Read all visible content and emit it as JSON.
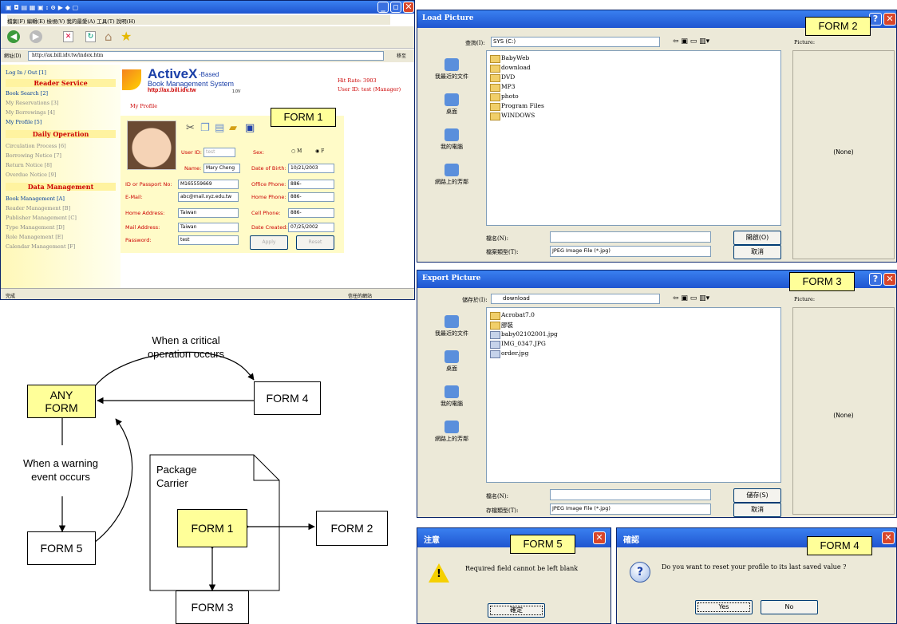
{
  "form1_browser": {
    "menu": "檔案(F)  編輯(E)  檢視(V)  我的最愛(A)  工具(T)  說明(H)",
    "address_label": "網址(D)",
    "url": "http://ax.bill.idv.tw/index.htm",
    "go": "移至",
    "logo_main": "ActiveX",
    "logo_based": "-Based",
    "logo_sub": "Book Management System",
    "logo_url": "http://ax.bill.idv.tw",
    "logo_ver": "1.0V",
    "hit_rate": "Hit Rate: 3903",
    "user_id": "User ID: test (Manager)",
    "sidebar": {
      "login": "Log In / Out [1]",
      "reader_head": "Reader Service",
      "reader_items": [
        "Book Search [2]",
        "My Reservations [3]",
        "My Borrowings [4]",
        "My Profile [5]"
      ],
      "daily_head": "Daily Operation",
      "daily_items": [
        "Circulation Process [6]",
        "Borrowing Notice [7]",
        "Return Notice [8]",
        "Overdue Notice [9]"
      ],
      "data_head": "Data Management",
      "data_items": [
        "Book Management [A]",
        "Reader Management [B]",
        "Publisher Management [C]",
        "Type Management [D]",
        "Role Management [E]",
        "Calendar Management [F]"
      ]
    },
    "profile_title": "My Profile",
    "fields": {
      "user_id_label": "User ID:",
      "user_id": "test",
      "name_label": "Name:",
      "name": "Mary Cheng",
      "sex_label": "Sex:",
      "sex_m": "M",
      "sex_f": "F",
      "dob_label": "Date of Birth:",
      "dob": "10/21/2003",
      "id_label": "ID or Passport No:",
      "id": "M165559669",
      "office_label": "Office Phone:",
      "office": "886-",
      "email_label": "E-Mail:",
      "email": "abc@mail.xyz.edu.tw",
      "home_phone_label": "Home Phone:",
      "home_phone": "886-",
      "home_addr_label": "Home Address:",
      "home_addr": "Taiwan",
      "cell_label": "Cell Phone:",
      "cell": "886-",
      "mail_addr_label": "Mail Address:",
      "mail_addr": "Taiwan",
      "created_label": "Date Created:",
      "created": "07/25/2002",
      "password_label": "Password:",
      "password": "test"
    },
    "apply": "Apply",
    "reset": "Reset",
    "status_left": "完成",
    "status_right": "信任的網站"
  },
  "form2_load": {
    "title": "Load Picture",
    "lookin_label": "查詢(I):",
    "lookin": "SYS (C:)",
    "picture": "Picture:",
    "places": [
      "我最近的文件",
      "桌面",
      "我的電腦",
      "網路上的芳鄰"
    ],
    "files": [
      "BabyWeb",
      "download",
      "DVD",
      "MP3",
      "photo",
      "Program Files",
      "WINDOWS"
    ],
    "none": "(None)",
    "filename_label": "檔名(N):",
    "filetype_label": "檔案類型(T):",
    "filetype": "JPEG Image File (*.jpg)",
    "open": "開啟(O)",
    "cancel": "取消"
  },
  "form3_export": {
    "title": "Export Picture",
    "savein_label": "儲存於(I):",
    "savein": "download",
    "picture": "Picture:",
    "places": [
      "我最近的文件",
      "桌面",
      "我的電腦",
      "網路上的芳鄰"
    ],
    "files": [
      "Acrobat7.0",
      "膠裝",
      "baby02102001.jpg",
      "IMG_0347.JPG",
      "order.jpg"
    ],
    "none": "(None)",
    "filename_label": "檔名(N):",
    "filetype_label": "存檔類型(T):",
    "filetype": "JPEG Image File (*.jpg)",
    "save": "儲存(S)",
    "cancel": "取消"
  },
  "form5_warning": {
    "title": "注意",
    "message": "Required field cannot be left blank",
    "ok": "確定"
  },
  "form4_confirm": {
    "title": "確認",
    "message": "Do you want to reset your profile to its last saved value ?",
    "yes": "Yes",
    "no": "No"
  },
  "tags": {
    "form1": "FORM 1",
    "form2": "FORM 2",
    "form3": "FORM 3",
    "form4": "FORM 4",
    "form5": "FORM 5"
  },
  "diagram": {
    "any_form": [
      "ANY",
      "FORM"
    ],
    "form4": "FORM 4",
    "form5": "FORM 5",
    "form1": "FORM 1",
    "form2": "FORM 2",
    "form3": "FORM 3",
    "critical": [
      "When a critical",
      "operation occurs"
    ],
    "warning": [
      "When a warning",
      "event occurs"
    ],
    "package": [
      "Package",
      "Carrier"
    ]
  }
}
